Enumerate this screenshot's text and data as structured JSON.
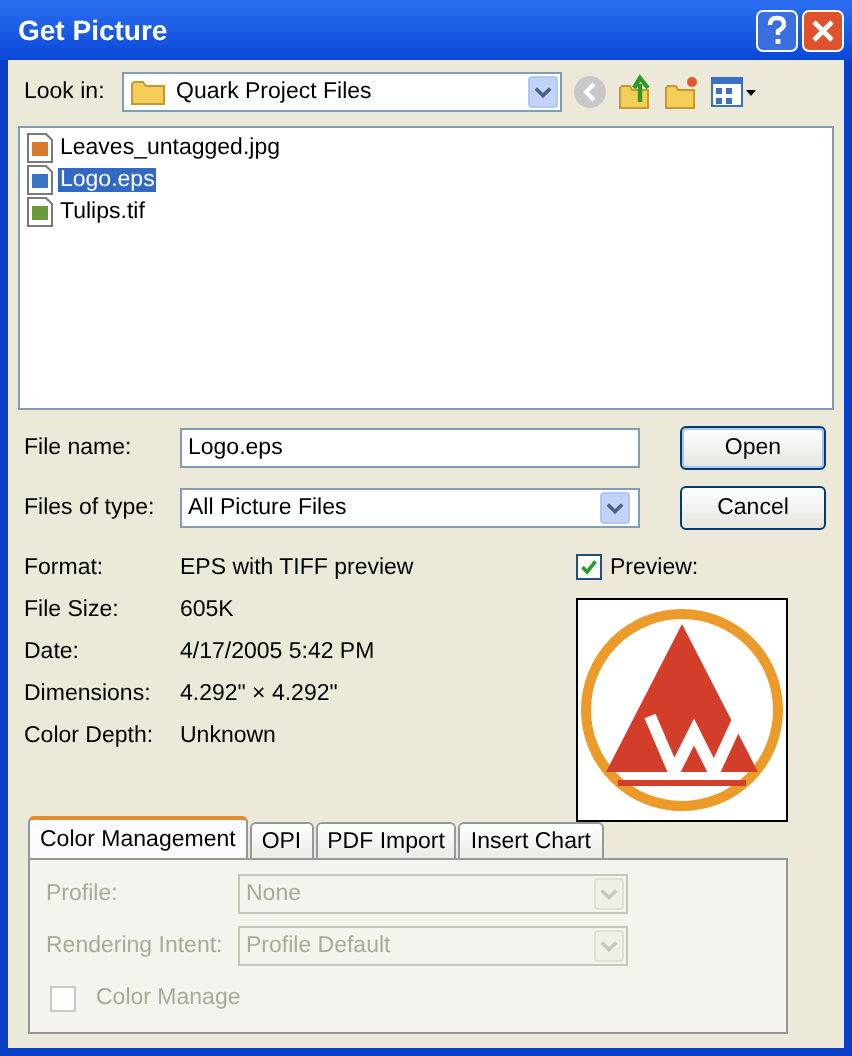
{
  "window": {
    "title": "Get Picture"
  },
  "look_in": {
    "label": "Look in:",
    "value": "Quark Project Files"
  },
  "files": [
    {
      "name": "Leaves_untagged.jpg",
      "kind": "jpg",
      "selected": false
    },
    {
      "name": "Logo.eps",
      "kind": "eps",
      "selected": true
    },
    {
      "name": "Tulips.tif",
      "kind": "tif",
      "selected": false
    }
  ],
  "file_name": {
    "label": "File name:",
    "value": "Logo.eps"
  },
  "file_type": {
    "label": "Files of type:",
    "value": "All Picture Files"
  },
  "buttons": [
    {
      "label": "Open",
      "default": true
    },
    {
      "label": "Cancel",
      "default": false
    }
  ],
  "info": [
    {
      "label": "Format:",
      "value": "EPS with TIFF preview"
    },
    {
      "label": "File Size:",
      "value": "605K"
    },
    {
      "label": "Date:",
      "value": "4/17/2005 5:42 PM"
    },
    {
      "label": "Dimensions:",
      "value": "4.292\" × 4.292\""
    },
    {
      "label": "Color Depth:",
      "value": "Unknown"
    }
  ],
  "preview": {
    "label": "Preview:",
    "checked": true
  },
  "tabs": [
    {
      "label": "Color Management",
      "selected": true
    },
    {
      "label": "OPI",
      "selected": false
    },
    {
      "label": "PDF Import",
      "selected": false
    },
    {
      "label": "Insert Chart",
      "selected": false
    }
  ],
  "color_management": {
    "disabled": true,
    "fields": [
      {
        "label": "Profile:",
        "value": "None"
      },
      {
        "label": "Rendering Intent:",
        "value": "Profile Default"
      }
    ],
    "color_manage": {
      "label": "Color Manage",
      "checked": false
    }
  }
}
